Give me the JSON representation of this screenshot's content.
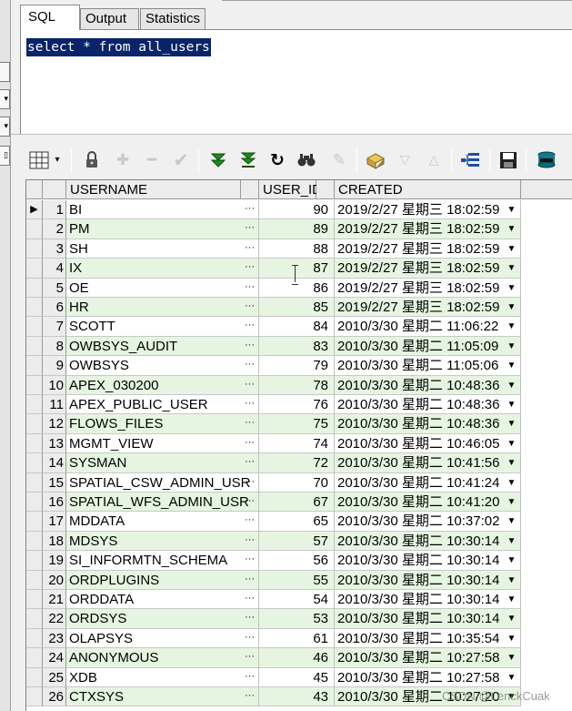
{
  "tabs": [
    {
      "label": "SQL",
      "active": true
    },
    {
      "label": "Output",
      "active": false
    },
    {
      "label": "Statistics",
      "active": false
    }
  ],
  "editor": {
    "sql": "select * from all_users",
    "selection_color": "#0a246a"
  },
  "toolbar": {
    "icons": [
      "grid-view-icon",
      "dropdown-arrow-icon",
      "lock-icon",
      "add-record-icon",
      "delete-record-icon",
      "post-changes-icon",
      "fetch-next-icon",
      "fetch-last-icon",
      "refresh-icon",
      "find-icon",
      "clear-icon",
      "query-by-example-icon",
      "filter-icon",
      "sort-icon",
      "explain-plan-icon",
      "save-icon",
      "export-icon"
    ]
  },
  "grid": {
    "columns": [
      "USERNAME",
      "USER_ID",
      "CREATED"
    ],
    "row_colors": {
      "even": "#e6f5e1",
      "odd": "#ffffff"
    },
    "rows": [
      {
        "no": "1",
        "username": "BI",
        "user_id": "90",
        "created": "2019/2/27 星期三 18:02:59"
      },
      {
        "no": "2",
        "username": "PM",
        "user_id": "89",
        "created": "2019/2/27 星期三 18:02:59"
      },
      {
        "no": "3",
        "username": "SH",
        "user_id": "88",
        "created": "2019/2/27 星期三 18:02:59"
      },
      {
        "no": "4",
        "username": "IX",
        "user_id": "87",
        "created": "2019/2/27 星期三 18:02:59"
      },
      {
        "no": "5",
        "username": "OE",
        "user_id": "86",
        "created": "2019/2/27 星期三 18:02:59"
      },
      {
        "no": "6",
        "username": "HR",
        "user_id": "85",
        "created": "2019/2/27 星期三 18:02:59"
      },
      {
        "no": "7",
        "username": "SCOTT",
        "user_id": "84",
        "created": "2010/3/30 星期二 11:06:22"
      },
      {
        "no": "8",
        "username": "OWBSYS_AUDIT",
        "user_id": "83",
        "created": "2010/3/30 星期二 11:05:09"
      },
      {
        "no": "9",
        "username": "OWBSYS",
        "user_id": "79",
        "created": "2010/3/30 星期二 11:05:06"
      },
      {
        "no": "10",
        "username": "APEX_030200",
        "user_id": "78",
        "created": "2010/3/30 星期二 10:48:36"
      },
      {
        "no": "11",
        "username": "APEX_PUBLIC_USER",
        "user_id": "76",
        "created": "2010/3/30 星期二 10:48:36"
      },
      {
        "no": "12",
        "username": "FLOWS_FILES",
        "user_id": "75",
        "created": "2010/3/30 星期二 10:48:36"
      },
      {
        "no": "13",
        "username": "MGMT_VIEW",
        "user_id": "74",
        "created": "2010/3/30 星期二 10:46:05"
      },
      {
        "no": "14",
        "username": "SYSMAN",
        "user_id": "72",
        "created": "2010/3/30 星期二 10:41:56"
      },
      {
        "no": "15",
        "username": "SPATIAL_CSW_ADMIN_USR",
        "user_id": "70",
        "created": "2010/3/30 星期二 10:41:24"
      },
      {
        "no": "16",
        "username": "SPATIAL_WFS_ADMIN_USR",
        "user_id": "67",
        "created": "2010/3/30 星期二 10:41:20"
      },
      {
        "no": "17",
        "username": "MDDATA",
        "user_id": "65",
        "created": "2010/3/30 星期二 10:37:02"
      },
      {
        "no": "18",
        "username": "MDSYS",
        "user_id": "57",
        "created": "2010/3/30 星期二 10:30:14"
      },
      {
        "no": "19",
        "username": "SI_INFORMTN_SCHEMA",
        "user_id": "56",
        "created": "2010/3/30 星期二 10:30:14"
      },
      {
        "no": "20",
        "username": "ORDPLUGINS",
        "user_id": "55",
        "created": "2010/3/30 星期二 10:30:14"
      },
      {
        "no": "21",
        "username": "ORDDATA",
        "user_id": "54",
        "created": "2010/3/30 星期二 10:30:14"
      },
      {
        "no": "22",
        "username": "ORDSYS",
        "user_id": "53",
        "created": "2010/3/30 星期二 10:30:14"
      },
      {
        "no": "23",
        "username": "OLAPSYS",
        "user_id": "61",
        "created": "2010/3/30 星期二 10:35:54"
      },
      {
        "no": "24",
        "username": "ANONYMOUS",
        "user_id": "46",
        "created": "2010/3/30 星期二 10:27:58"
      },
      {
        "no": "25",
        "username": "XDB",
        "user_id": "45",
        "created": "2010/3/30 星期二 10:27:58"
      },
      {
        "no": "26",
        "username": "CTXSYS",
        "user_id": "43",
        "created": "2010/3/30 星期二 10:27:20"
      }
    ]
  },
  "watermark": "CSDN @LenckCuak"
}
